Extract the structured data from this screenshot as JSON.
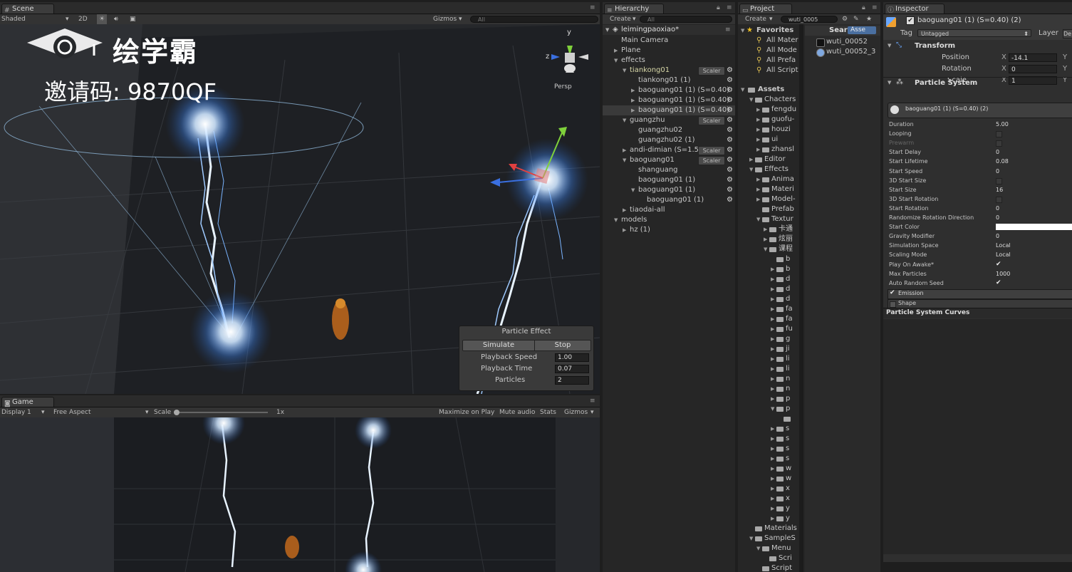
{
  "scene_panel": {
    "tab": "Scene",
    "shading": "Shaded",
    "mode_2d": "2D",
    "gizmos": "Gizmos",
    "search_placeholder": "All",
    "persp_label": "Persp",
    "axis_y": "y",
    "axis_z": "z"
  },
  "watermark": {
    "brand": "绘学霸",
    "invite": "邀请码: 9870QF"
  },
  "particle_effect": {
    "title": "Particle Effect",
    "simulate": "Simulate",
    "stop": "Stop",
    "rows": [
      {
        "label": "Playback Speed",
        "value": "1.00"
      },
      {
        "label": "Playback Time",
        "value": "0.07"
      },
      {
        "label": "Particles",
        "value": "2"
      }
    ]
  },
  "game_panel": {
    "tab": "Game",
    "display": "Display 1",
    "aspect": "Free Aspect",
    "scale_label": "Scale",
    "scale_value": "1x",
    "maximize": "Maximize on Play",
    "mute": "Mute audio",
    "stats": "Stats",
    "gizmos": "Gizmos"
  },
  "hierarchy": {
    "tab": "Hierarchy",
    "create": "Create",
    "search_placeholder": "All",
    "scene_name": "leimingpaoxiao*",
    "items": [
      {
        "label": "Main Camera",
        "indent": 0,
        "arrow": ""
      },
      {
        "label": "Plane",
        "indent": 0,
        "arrow": "right"
      },
      {
        "label": "effects",
        "indent": 0,
        "arrow": "down"
      },
      {
        "label": "tiankong01",
        "indent": 1,
        "arrow": "down",
        "scaler": "Scaler",
        "gear": true
      },
      {
        "label": "tiankong01 (1)",
        "indent": 2,
        "arrow": "",
        "gear": true
      },
      {
        "label": "baoguang01 (1) (S=0.40)",
        "indent": 2,
        "arrow": "right",
        "gear": true
      },
      {
        "label": "baoguang01 (1) (S=0.40)",
        "indent": 2,
        "arrow": "right",
        "gear": true
      },
      {
        "label": "baoguang01 (1) (S=0.40)",
        "indent": 2,
        "arrow": "right",
        "gear": true,
        "selected": true
      },
      {
        "label": "guangzhu",
        "indent": 1,
        "arrow": "down",
        "scaler": "Scaler",
        "gear": true
      },
      {
        "label": "guangzhu02",
        "indent": 2,
        "arrow": "",
        "gear": true
      },
      {
        "label": "guangzhu02 (1)",
        "indent": 2,
        "arrow": "",
        "gear": true
      },
      {
        "label": "andi-dimian (S=1.5",
        "indent": 1,
        "arrow": "right",
        "scaler": "Scaler",
        "gear": true
      },
      {
        "label": "baoguang01",
        "indent": 1,
        "arrow": "down",
        "scaler": "Scaler",
        "gear": true
      },
      {
        "label": "shanguang",
        "indent": 2,
        "arrow": "",
        "gear": true
      },
      {
        "label": "baoguang01 (1)",
        "indent": 2,
        "arrow": "",
        "gear": true
      },
      {
        "label": "baoguang01 (1)",
        "indent": 2,
        "arrow": "down",
        "gear": true
      },
      {
        "label": "baoguang01 (1)",
        "indent": 3,
        "arrow": "",
        "gear": true
      },
      {
        "label": "tiaodai-all",
        "indent": 1,
        "arrow": "right"
      },
      {
        "label": "models",
        "indent": 0,
        "arrow": "down"
      },
      {
        "label": "hz (1)",
        "indent": 1,
        "arrow": "right"
      }
    ]
  },
  "project": {
    "tab": "Project",
    "create": "Create",
    "search_value": "wuti_0005",
    "favorites_label": "Favorites",
    "favorites": [
      "All Mater",
      "All Mode",
      "All Prefa",
      "All Script"
    ],
    "search_header": "Sear",
    "search_scope": "Asse",
    "results": [
      "wuti_00052",
      "wuti_00052_3"
    ],
    "assets_label": "Assets",
    "tree": [
      {
        "label": "Chacters",
        "indent": 1,
        "arrow": "down"
      },
      {
        "label": "fengdu",
        "indent": 2,
        "arrow": "right"
      },
      {
        "label": "guofu-",
        "indent": 2,
        "arrow": "right"
      },
      {
        "label": "houzi",
        "indent": 2,
        "arrow": "right"
      },
      {
        "label": "ui",
        "indent": 2,
        "arrow": "right"
      },
      {
        "label": "zhansl",
        "indent": 2,
        "arrow": "right"
      },
      {
        "label": "Editor",
        "indent": 1,
        "arrow": "right"
      },
      {
        "label": "Effects",
        "indent": 1,
        "arrow": "down"
      },
      {
        "label": "Anima",
        "indent": 2,
        "arrow": "right"
      },
      {
        "label": "Materi",
        "indent": 2,
        "arrow": "right"
      },
      {
        "label": "Model-",
        "indent": 2,
        "arrow": "right"
      },
      {
        "label": "Prefab",
        "indent": 2,
        "arrow": ""
      },
      {
        "label": "Textur",
        "indent": 2,
        "arrow": "down"
      },
      {
        "label": "卡通",
        "indent": 3,
        "arrow": "right"
      },
      {
        "label": "炫丽",
        "indent": 3,
        "arrow": "right"
      },
      {
        "label": "课程",
        "indent": 3,
        "arrow": "down"
      },
      {
        "label": "b",
        "indent": 4,
        "arrow": ""
      },
      {
        "label": "b",
        "indent": 4,
        "arrow": "right"
      },
      {
        "label": "d",
        "indent": 4,
        "arrow": "right"
      },
      {
        "label": "d",
        "indent": 4,
        "arrow": "right"
      },
      {
        "label": "d",
        "indent": 4,
        "arrow": "right"
      },
      {
        "label": "fa",
        "indent": 4,
        "arrow": "right"
      },
      {
        "label": "fa",
        "indent": 4,
        "arrow": "right"
      },
      {
        "label": "fu",
        "indent": 4,
        "arrow": "right"
      },
      {
        "label": "g",
        "indent": 4,
        "arrow": "right"
      },
      {
        "label": "ji",
        "indent": 4,
        "arrow": "right"
      },
      {
        "label": "li",
        "indent": 4,
        "arrow": "right"
      },
      {
        "label": "li",
        "indent": 4,
        "arrow": "right"
      },
      {
        "label": "n",
        "indent": 4,
        "arrow": "right"
      },
      {
        "label": "n",
        "indent": 4,
        "arrow": "right"
      },
      {
        "label": "p",
        "indent": 4,
        "arrow": "right"
      },
      {
        "label": "p",
        "indent": 4,
        "arrow": "down"
      },
      {
        "label": "",
        "indent": 5,
        "arrow": ""
      },
      {
        "label": "s",
        "indent": 4,
        "arrow": "right"
      },
      {
        "label": "s",
        "indent": 4,
        "arrow": "right"
      },
      {
        "label": "s",
        "indent": 4,
        "arrow": "right"
      },
      {
        "label": "s",
        "indent": 4,
        "arrow": "right"
      },
      {
        "label": "w",
        "indent": 4,
        "arrow": "right"
      },
      {
        "label": "w",
        "indent": 4,
        "arrow": "right"
      },
      {
        "label": "x",
        "indent": 4,
        "arrow": "right"
      },
      {
        "label": "x",
        "indent": 4,
        "arrow": "right"
      },
      {
        "label": "y",
        "indent": 4,
        "arrow": "right"
      },
      {
        "label": "y",
        "indent": 4,
        "arrow": "right"
      },
      {
        "label": "Materials",
        "indent": 1,
        "arrow": ""
      },
      {
        "label": "SampleS",
        "indent": 1,
        "arrow": "down"
      },
      {
        "label": "Menu",
        "indent": 2,
        "arrow": "down"
      },
      {
        "label": "Scri",
        "indent": 3,
        "arrow": ""
      },
      {
        "label": "Script",
        "indent": 2,
        "arrow": ""
      }
    ]
  },
  "inspector": {
    "tab": "Inspector",
    "object_name": "baoguang01 (1) (S=0.40) (2)",
    "tag_label": "Tag",
    "tag_value": "Untagged",
    "layer_label": "Layer",
    "layer_value": "De",
    "transform_label": "Transform",
    "transform": [
      {
        "label": "Position",
        "x": "-14.1",
        "y_label": "Y"
      },
      {
        "label": "Rotation",
        "x": "0",
        "y_label": "Y"
      },
      {
        "label": "Scale",
        "x": "1",
        "y_label": "Y"
      }
    ],
    "particle_system_label": "Particle System",
    "ps_title": "baoguang01 (1) (S=0.40) (2)",
    "properties": [
      {
        "label": "Duration",
        "value": "5.00"
      },
      {
        "label": "Looping",
        "value": "",
        "type": "checkbox",
        "checked": false
      },
      {
        "label": "Prewarm",
        "value": "",
        "type": "checkbox",
        "checked": false,
        "disabled": true
      },
      {
        "label": "Start Delay",
        "value": "0"
      },
      {
        "label": "Start Lifetime",
        "value": "0.08"
      },
      {
        "label": "Start Speed",
        "value": "0"
      },
      {
        "label": "3D Start Size",
        "value": "",
        "type": "checkbox",
        "checked": false
      },
      {
        "label": "Start Size",
        "value": "16"
      },
      {
        "label": "3D Start Rotation",
        "value": "",
        "type": "checkbox",
        "checked": false
      },
      {
        "label": "Start Rotation",
        "value": "0"
      },
      {
        "label": "Randomize Rotation Direction",
        "value": "0"
      },
      {
        "label": "Start Color",
        "value": "",
        "type": "color"
      },
      {
        "label": "Gravity Modifier",
        "value": "0"
      },
      {
        "label": "Simulation Space",
        "value": "Local"
      },
      {
        "label": "Scaling Mode",
        "value": "Local"
      },
      {
        "label": "Play On Awake*",
        "value": "✔",
        "type": "checkbox",
        "checked": true
      },
      {
        "label": "Max Particles",
        "value": "1000"
      },
      {
        "label": "Auto Random Seed",
        "value": "✔",
        "type": "checkbox",
        "checked": true
      }
    ],
    "emission": "Emission",
    "shape": "Shape",
    "curves": "Particle System Curves"
  }
}
